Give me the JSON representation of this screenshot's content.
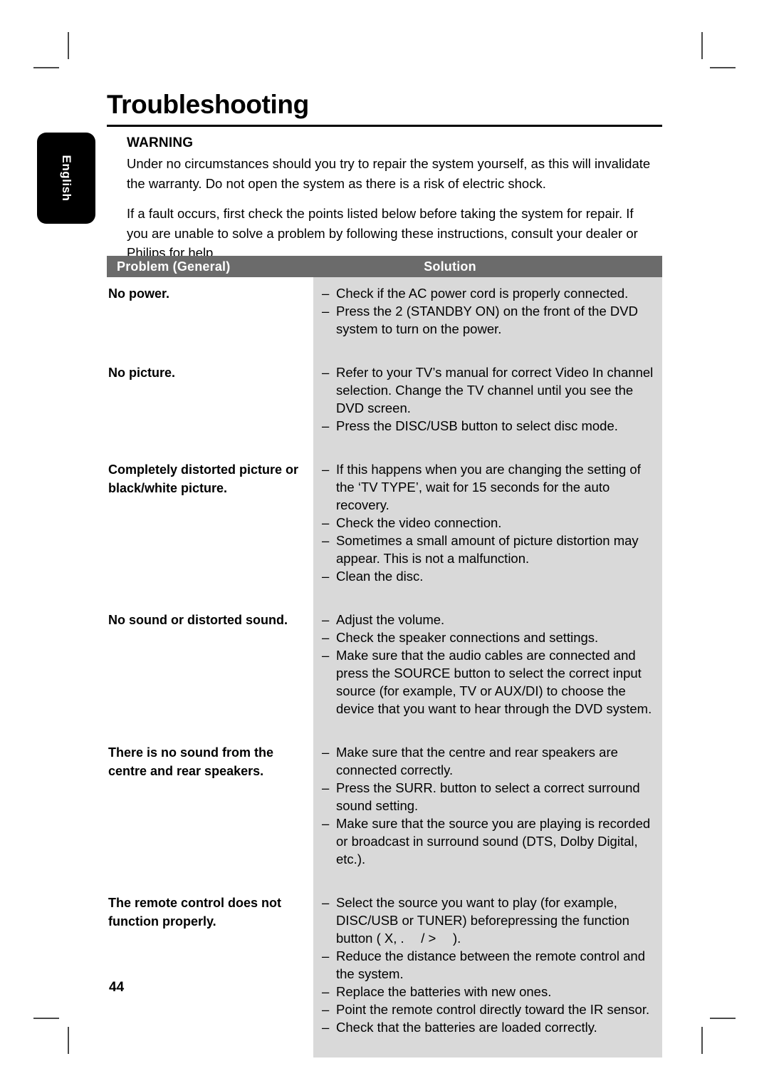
{
  "page": {
    "title": "Troubleshooting",
    "number": "44",
    "language_tab": "English"
  },
  "warning": {
    "heading": "WARNING",
    "paragraphs": [
      "Under no circumstances should you try to repair the system yourself, as this will invalidate the warranty. Do not open the system as there is a risk of electric shock.",
      "If a fault occurs, first check the points listed below before taking the system for repair. If you are unable to solve a problem by following these instructions, consult your dealer or Philips for help."
    ]
  },
  "table": {
    "headers": {
      "problem": "Problem (General)",
      "solution": "Solution"
    },
    "rows": [
      {
        "problem": "No power.",
        "solutions": [
          "Check if the AC power cord is properly connected.",
          "Press the 2  (STANDBY ON) on the front of the DVD system to turn on the power."
        ]
      },
      {
        "problem": "No picture.",
        "solutions": [
          "Refer to your TV’s manual for correct Video In channel selection. Change the TV channel until you see the DVD screen.",
          "Press the DISC/USB button to select disc mode."
        ]
      },
      {
        "problem": "Completely distorted picture or black/white picture.",
        "solutions": [
          "If this happens when you are changing the setting of the ‘TV TYPE’, wait for 15 seconds for the auto recovery.",
          "Check the video connection.",
          "Sometimes a small amount of picture distortion may appear. This is not a malfunction.",
          "Clean the disc."
        ]
      },
      {
        "problem": "No sound or distorted sound.",
        "solutions": [
          "Adjust the volume.",
          "Check the speaker connections and settings.",
          "Make sure that the audio cables are connected and press the SOURCE button to select the correct input source (for example, TV or AUX/DI) to choose the device that you want to hear through the DVD system."
        ]
      },
      {
        "problem": "There is no sound from the centre and rear speakers.",
        "solutions": [
          "Make sure that the centre and rear speakers are connected correctly.",
          "Press the SURR. button to select a correct surround sound setting.",
          "Make sure that the source you are playing is recorded or broadcast in surround sound (DTS, Dolby Digital, etc.)."
        ]
      },
      {
        "problem": "The remote control does not function properly.",
        "solutions": [
          "Select the source you want to play (for example, DISC/USB or TUNER) beforepressing the function button ( X, .  / >  ).",
          "Reduce the distance between the remote control and the system.",
          "Replace the batteries with new ones.",
          "Point the remote control directly toward the IR sensor.",
          "Check that the batteries are loaded correctly."
        ]
      }
    ],
    "bullet_dash": "–"
  },
  "colors": {
    "header_bg": "#6b6b6b",
    "solution_bg": "#d9d9d9",
    "tab_bg": "#000000",
    "rule": "#000000"
  }
}
